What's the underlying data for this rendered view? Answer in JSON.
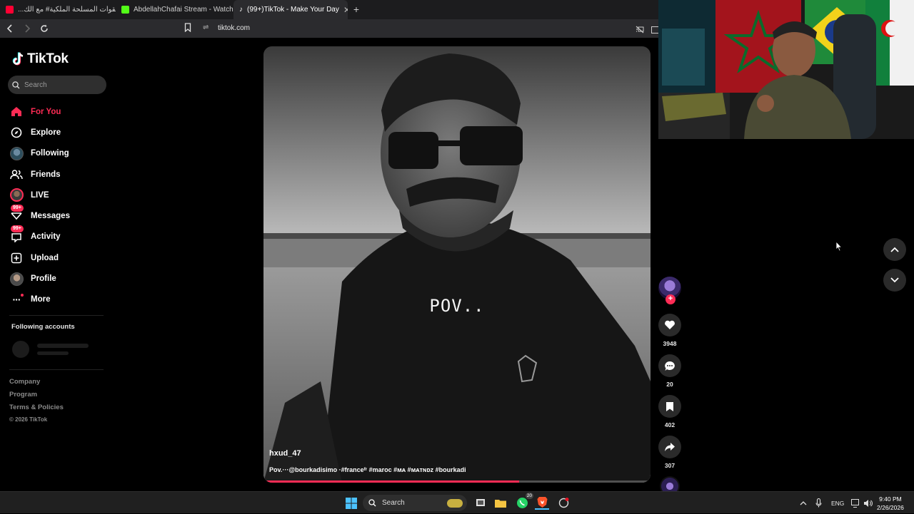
{
  "browser": {
    "tabs": [
      {
        "title": "نشيد القوات المسلحة الملكية# مع الك...",
        "favicon": "youtube-icon",
        "color": "#ff0033"
      },
      {
        "title": "AbdellahChafai Stream - Watch Live o...",
        "favicon": "kick-icon",
        "color": "#53fc18"
      },
      {
        "title": "(99+)TikTok - Make Your Day",
        "favicon": "tiktok-icon",
        "color": "#ffffff",
        "active": true
      }
    ],
    "url": "tiktok.com"
  },
  "sidebar": {
    "brand": "TikTok",
    "search_placeholder": "Search",
    "nav": [
      {
        "label": "For You",
        "icon": "home-icon",
        "active": true
      },
      {
        "label": "Explore",
        "icon": "compass-icon"
      },
      {
        "label": "Following",
        "icon": "following-avatar"
      },
      {
        "label": "Friends",
        "icon": "friends-icon"
      },
      {
        "label": "LIVE",
        "icon": "live-avatar"
      },
      {
        "label": "Messages",
        "icon": "messages-icon",
        "badge": "99+"
      },
      {
        "label": "Activity",
        "icon": "activity-icon",
        "badge": "99+"
      },
      {
        "label": "Upload",
        "icon": "upload-icon"
      },
      {
        "label": "Profile",
        "icon": "profile-avatar"
      },
      {
        "label": "More",
        "icon": "more-icon"
      }
    ],
    "following_accounts_title": "Following accounts",
    "footer": {
      "links": [
        "Company",
        "Program",
        "Terms & Policies"
      ],
      "copyright": "© 2026 TikTok"
    }
  },
  "video": {
    "overlay_text": "POV..",
    "author": "hxud_47",
    "caption": "Pov.···@bourkadisimo ·#franceᶠʳ #maroc #ᴍᴀ #ᴍᴀᴛɴᴅᴢ #bourkadi",
    "progress_fraction": 0.66
  },
  "actions": {
    "likes": "3948",
    "comments": "20",
    "saves": "402",
    "shares": "307"
  },
  "taskbar": {
    "search_label": "Search",
    "whatsapp_badge": "20",
    "language": "ENG",
    "time": "9:40 PM",
    "date": "2/26/2026"
  },
  "colors": {
    "accent": "#fe2c55",
    "sidebar_bg": "#000000",
    "chrome_bg": "#2b2b2e"
  }
}
